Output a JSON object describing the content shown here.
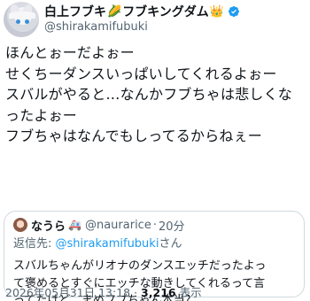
{
  "author": {
    "display_name": "白上フブキ",
    "name_emoji_1": "🌽",
    "name_suffix": "フブキングダム",
    "name_emoji_2": "👑",
    "handle": "@shirakamifubuki"
  },
  "tweet": {
    "lines": [
      "ほんとぉーだよぉー",
      "せくちーダンスいっぱいしてくれるよぉー",
      "スバルがやると…なんかフブちゃは悲しくな",
      "ったよぉー",
      "フブちゃはなんでもしってるからねぇー"
    ]
  },
  "quote": {
    "name": "なうら",
    "car_emoji": "🚑",
    "handle": "@naurarice",
    "separator": "·",
    "time": "20分",
    "reply_prefix": "返信先: ",
    "reply_mention": "@shirakamifubuki",
    "reply_suffix": "さん",
    "lines": [
      "スバルちゃんがリオナのダンスエッチだったよっ",
      "て褒めるとすぐにエッチな動きしてくれるって言",
      "ってたけど、まめフブちゃん本当？"
    ]
  },
  "footer": {
    "timestamp": "2026年05月31日 13:18",
    "separator": " · ",
    "views_count": "3,216",
    "views_label": " 表示"
  },
  "colors": {
    "verified_badge": "#1d9bf0",
    "secondary_text": "#536471",
    "link": "#1d9bf0"
  }
}
